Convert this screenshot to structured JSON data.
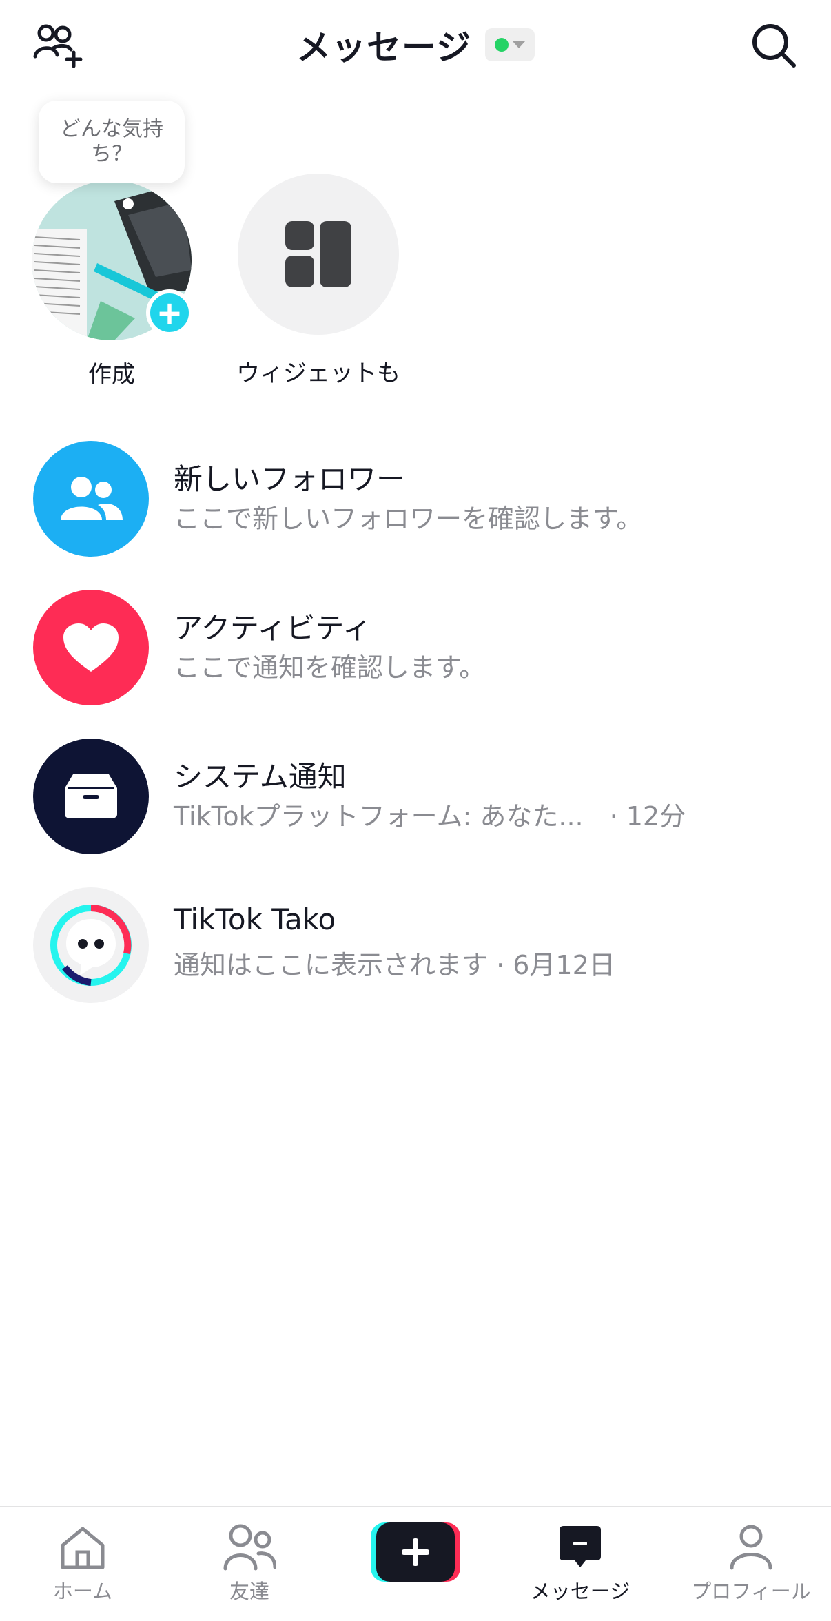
{
  "header": {
    "title": "メッセージ",
    "status_color": "#25d366",
    "icons": {
      "left": "add-friend-icon",
      "right": "search-icon"
    }
  },
  "stories": {
    "bubble_text": "どんな気持ち？",
    "create_label": "作成",
    "widget_label": "ウィジェットも"
  },
  "list": [
    {
      "title": "新しいフォロワー",
      "subtitle": "ここで新しいフォロワーを確認します。",
      "icon": "followers-icon",
      "color": "#1caff3"
    },
    {
      "title": "アクティビティ",
      "subtitle": "ここで通知を確認します。",
      "icon": "heart-icon",
      "color": "#fe2c55"
    },
    {
      "title": "システム通知",
      "subtitle": "TikTokプラットフォーム: あなた...　· 12分",
      "icon": "inbox-icon",
      "color": "#0e1434"
    },
    {
      "title": "TikTok Tako",
      "subtitle": "通知はここに表示されます · 6月12日",
      "icon": "tako-icon",
      "color": "#f1f1f2"
    }
  ],
  "tabbar": {
    "home": "ホーム",
    "friends": "友達",
    "messages": "メッセージ",
    "profile": "プロフィール",
    "active": "messages",
    "accent_cyan": "#25f4ee",
    "accent_red": "#fe2c55"
  }
}
